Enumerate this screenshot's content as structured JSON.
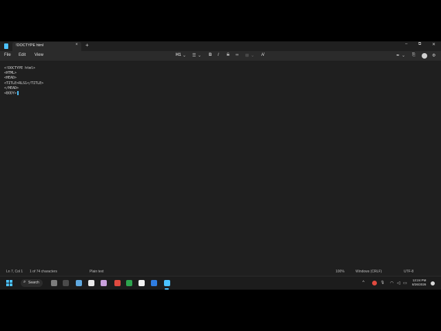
{
  "window": {
    "tab_title": "!DOCTYPE html",
    "tab_close": "×",
    "new_tab": "+",
    "minimize": "–",
    "maximize": "⧉",
    "close": "✕"
  },
  "menu": {
    "file": "File",
    "edit": "Edit",
    "view": "View"
  },
  "toolbar": {
    "heading": "H1",
    "heading_chevron": "⌄",
    "list": "☰",
    "list_chevron": "⌄",
    "bold": "B",
    "italic": "I",
    "underline": "I",
    "strike": "S",
    "link": "∞",
    "table": "⊞",
    "table_chevron": "⌄",
    "clear_format": "A̸",
    "copilot": "✒",
    "copilot_chevron": "⌄",
    "share": "⎘",
    "settings": "⚙"
  },
  "editor": {
    "lines": [
      "<!DOCTYPE html>",
      "<HTML>",
      "<HEAD>",
      "<TITLE>RLS1</TITLE>",
      "</HEAD>",
      "<BODY>"
    ]
  },
  "status": {
    "position": "Ln 7, Col 1",
    "characters": "1 of 74 characters",
    "format": "Plain text",
    "zoom": "100%",
    "line_endings": "Windows (CRLF)",
    "encoding": "UTF-8"
  },
  "taskbar": {
    "search_label": "Search",
    "search_glyph": "⌕",
    "icons": [
      {
        "name": "copilot-icon",
        "color": "#7d7d7d"
      },
      {
        "name": "terminal-icon",
        "color": "#4a4a4a"
      },
      {
        "name": "edit-app-icon",
        "color": "#5fa8e0"
      },
      {
        "name": "calendar-icon",
        "color": "#e8e8e8"
      },
      {
        "name": "snipping-tool-icon",
        "color": "#c9a0dc"
      },
      {
        "name": "chrome-icon",
        "color": "#e04a3f"
      },
      {
        "name": "meet-icon",
        "color": "#2da44e"
      },
      {
        "name": "file-icon",
        "color": "#f2f2f2"
      },
      {
        "name": "edge-icon",
        "color": "#2f7de1"
      },
      {
        "name": "notepad-icon",
        "color": "#4cc2ff"
      }
    ],
    "tray_chevron": "^",
    "tray_mic": "🎙",
    "tray_wifi": "◠",
    "tray_volume": "◁",
    "tray_battery": "▭",
    "time": "12:24 PM",
    "date": "8/26/2026"
  }
}
